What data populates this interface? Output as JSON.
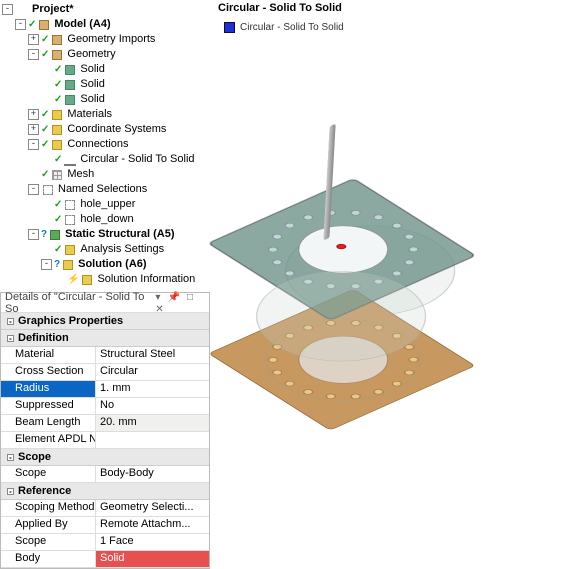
{
  "viewport": {
    "title": "Circular - Solid To Solid",
    "legend_label": "Circular - Solid To Solid",
    "legend_color": "#2030d8"
  },
  "tree": {
    "root": "Project*",
    "nodes": [
      {
        "depth": 0,
        "exp": "-",
        "status": "",
        "icon": "",
        "label": "Project*",
        "bold": true
      },
      {
        "depth": 1,
        "exp": "-",
        "status": "tick",
        "icon": "cube",
        "label": "Model (A4)",
        "bold": true
      },
      {
        "depth": 2,
        "exp": "+",
        "status": "tick",
        "icon": "cube",
        "label": "Geometry Imports",
        "bold": false
      },
      {
        "depth": 2,
        "exp": "-",
        "status": "tick",
        "icon": "cube",
        "label": "Geometry",
        "bold": false
      },
      {
        "depth": 3,
        "exp": "",
        "status": "tick",
        "icon": "cube-g",
        "label": "Solid",
        "bold": false
      },
      {
        "depth": 3,
        "exp": "",
        "status": "tick",
        "icon": "cube-g",
        "label": "Solid",
        "bold": false
      },
      {
        "depth": 3,
        "exp": "",
        "status": "tick",
        "icon": "cube-g",
        "label": "Solid",
        "bold": false
      },
      {
        "depth": 2,
        "exp": "+",
        "status": "tick",
        "icon": "yellow",
        "label": "Materials",
        "bold": false
      },
      {
        "depth": 2,
        "exp": "+",
        "status": "tick",
        "icon": "coord",
        "label": "Coordinate Systems",
        "bold": false
      },
      {
        "depth": 2,
        "exp": "-",
        "status": "tick",
        "icon": "yellow",
        "label": "Connections",
        "bold": false
      },
      {
        "depth": 3,
        "exp": "",
        "status": "tick",
        "icon": "line",
        "label": "Circular - Solid To Solid",
        "bold": false
      },
      {
        "depth": 2,
        "exp": "",
        "status": "tick",
        "icon": "mesh",
        "label": "Mesh",
        "bold": false
      },
      {
        "depth": 2,
        "exp": "-",
        "status": "",
        "icon": "sel",
        "label": "Named Selections",
        "bold": false
      },
      {
        "depth": 3,
        "exp": "",
        "status": "tick",
        "icon": "sel",
        "label": "hole_upper",
        "bold": false
      },
      {
        "depth": 3,
        "exp": "",
        "status": "tick",
        "icon": "sel",
        "label": "hole_down",
        "bold": false
      },
      {
        "depth": 2,
        "exp": "-",
        "status": "qm",
        "icon": "green",
        "label": "Static Structural (A5)",
        "bold": true
      },
      {
        "depth": 3,
        "exp": "",
        "status": "tick",
        "icon": "yellow",
        "label": "Analysis Settings",
        "bold": false
      },
      {
        "depth": 3,
        "exp": "-",
        "status": "qm",
        "icon": "yellow",
        "label": "Solution (A6)",
        "bold": true
      },
      {
        "depth": 4,
        "exp": "",
        "status": "lbolt",
        "icon": "yellow",
        "label": "Solution Information",
        "bold": false
      }
    ]
  },
  "details": {
    "title": "Details of \"Circular - Solid To So",
    "groups": [
      {
        "name": "Graphics Properties",
        "rows": []
      },
      {
        "name": "Definition",
        "rows": [
          {
            "key": "Material",
            "val": "Structural Steel",
            "flags": ""
          },
          {
            "key": "Cross Section",
            "val": "Circular",
            "flags": ""
          },
          {
            "key": "Radius",
            "val": "1. mm",
            "flags": "selected"
          },
          {
            "key": "Suppressed",
            "val": "No",
            "flags": ""
          },
          {
            "key": "Beam Length",
            "val": "20. mm",
            "flags": "readonly"
          },
          {
            "key": "Element APDL Name",
            "val": "",
            "flags": ""
          }
        ]
      },
      {
        "name": "Scope",
        "rows": [
          {
            "key": "Scope",
            "val": "Body-Body",
            "flags": ""
          }
        ]
      },
      {
        "name": "Reference",
        "rows": [
          {
            "key": "Scoping Method",
            "val": "Geometry Selecti...",
            "flags": ""
          },
          {
            "key": "Applied By",
            "val": "Remote Attachm...",
            "flags": ""
          },
          {
            "key": "Scope",
            "val": "1 Face",
            "flags": ""
          },
          {
            "key": "Body",
            "val": "Solid",
            "flags": "error"
          }
        ]
      }
    ]
  }
}
